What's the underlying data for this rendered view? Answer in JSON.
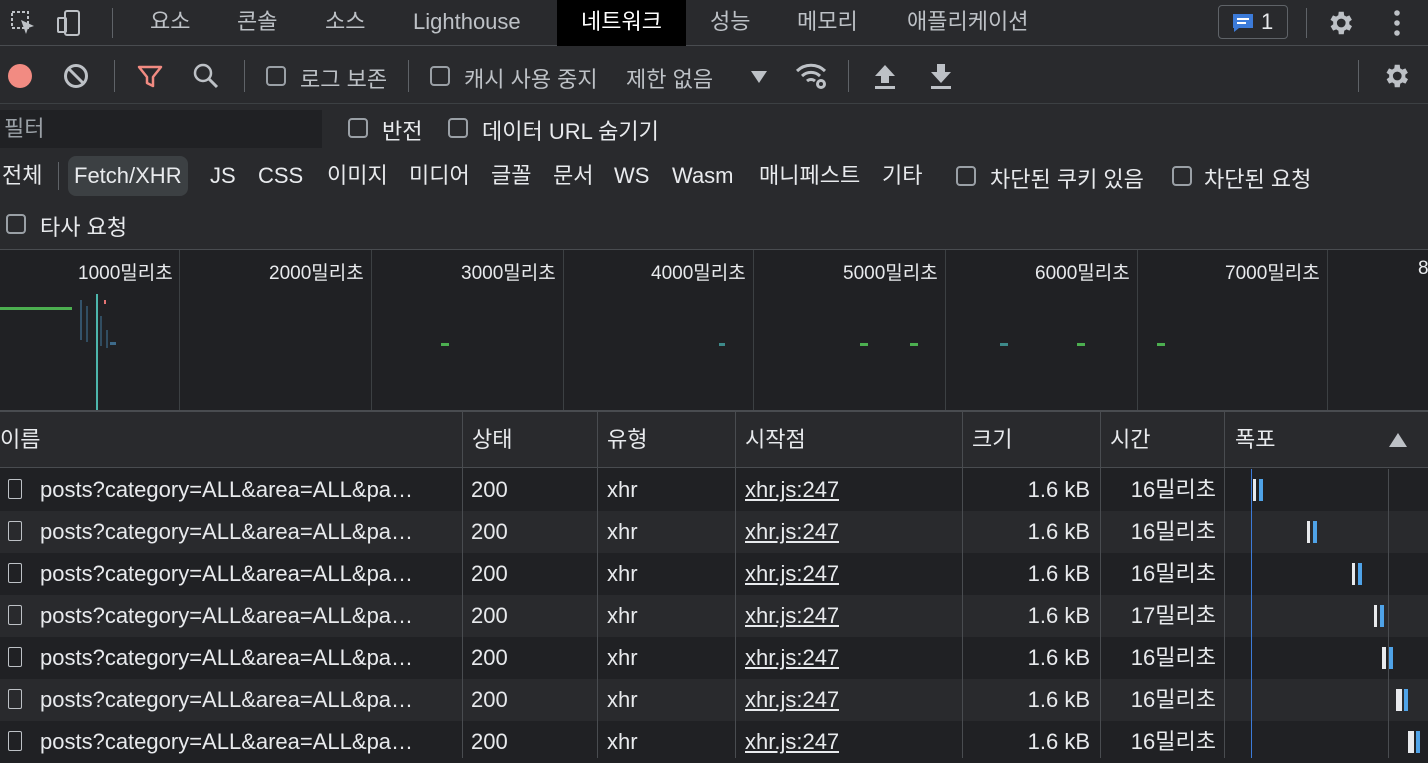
{
  "tabs": {
    "elements": "요소",
    "console": "콘솔",
    "sources": "소스",
    "lighthouse": "Lighthouse",
    "network": "네트워크",
    "performance": "성능",
    "memory": "메모리",
    "application": "애플리케이션"
  },
  "issues_count": "1",
  "toolbar": {
    "preserve_log": "로그 보존",
    "disable_cache": "캐시 사용 중지",
    "throttling": "제한 없음"
  },
  "filter": {
    "placeholder": "필터",
    "invert": "반전",
    "hide_data_urls": "데이터 URL 숨기기",
    "types": [
      "전체",
      "Fetch/XHR",
      "JS",
      "CSS",
      "이미지",
      "미디어",
      "글꼴",
      "문서",
      "WS",
      "Wasm",
      "매니페스트",
      "기타"
    ],
    "selected_type": "Fetch/XHR",
    "blocked_cookies": "차단된 쿠키 있음",
    "blocked_requests": "차단된 요청",
    "third_party": "타사 요청"
  },
  "overview": {
    "ticks": [
      "1000밀리초",
      "2000밀리초",
      "3000밀리초",
      "4000밀리초",
      "5000밀리초",
      "6000밀리초",
      "7000밀리초",
      "8"
    ]
  },
  "table": {
    "columns": {
      "name": "이름",
      "status": "상태",
      "type": "유형",
      "initiator": "시작점",
      "size": "크기",
      "time": "시간",
      "waterfall": "폭포"
    },
    "rows": [
      {
        "name": "posts?category=ALL&area=ALL&pa…",
        "status": "200",
        "type": "xhr",
        "initiator": "xhr.js:247",
        "size": "1.6 kB",
        "time": "16밀리초"
      },
      {
        "name": "posts?category=ALL&area=ALL&pa…",
        "status": "200",
        "type": "xhr",
        "initiator": "xhr.js:247",
        "size": "1.6 kB",
        "time": "16밀리초"
      },
      {
        "name": "posts?category=ALL&area=ALL&pa…",
        "status": "200",
        "type": "xhr",
        "initiator": "xhr.js:247",
        "size": "1.6 kB",
        "time": "16밀리초"
      },
      {
        "name": "posts?category=ALL&area=ALL&pa…",
        "status": "200",
        "type": "xhr",
        "initiator": "xhr.js:247",
        "size": "1.6 kB",
        "time": "17밀리초"
      },
      {
        "name": "posts?category=ALL&area=ALL&pa…",
        "status": "200",
        "type": "xhr",
        "initiator": "xhr.js:247",
        "size": "1.6 kB",
        "time": "16밀리초"
      },
      {
        "name": "posts?category=ALL&area=ALL&pa…",
        "status": "200",
        "type": "xhr",
        "initiator": "xhr.js:247",
        "size": "1.6 kB",
        "time": "16밀리초"
      },
      {
        "name": "posts?category=ALL&area=ALL&pa…",
        "status": "200",
        "type": "xhr",
        "initiator": "xhr.js:247",
        "size": "1.6 kB",
        "time": "16밀리초"
      }
    ]
  },
  "colors": {
    "record": "#f28b82",
    "filter_active": "#f28b82",
    "issues_badge": "#8ab4f8",
    "waterfall_bar": "#4fa3e8",
    "overview_green": "#4caf50"
  }
}
